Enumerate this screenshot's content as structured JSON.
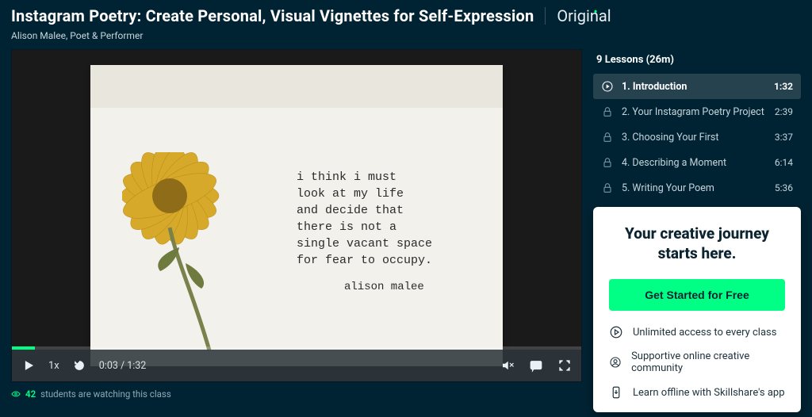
{
  "header": {
    "title": "Instagram Poetry: Create Personal, Visual Vignettes for Self-Expression",
    "badge": "Original",
    "author": "Alison Malee, Poet & Performer"
  },
  "video": {
    "poem_text": "i think i must\nlook at my life\nand decide that\nthere is not a\nsingle vacant space\nfor fear to occupy.",
    "poem_signature": "alison malee",
    "speed": "1x",
    "current_time": "0:03",
    "duration": "1:32",
    "watching_count": "42",
    "watching_suffix": "students are watching this class"
  },
  "lessons": {
    "header": "9 Lessons (26m)",
    "items": [
      {
        "label": "1. Introduction",
        "duration": "1:32",
        "active": true
      },
      {
        "label": "2. Your Instagram Poetry Project",
        "duration": "2:39",
        "active": false
      },
      {
        "label": "3. Choosing Your First",
        "duration": "3:37",
        "active": false
      },
      {
        "label": "4. Describing a Moment",
        "duration": "6:14",
        "active": false
      },
      {
        "label": "5. Writing Your Poem",
        "duration": "5:36",
        "active": false
      }
    ]
  },
  "cta": {
    "title_line1": "Your creative journey",
    "title_line2": "starts here.",
    "button": "Get Started for Free",
    "benefits": [
      "Unlimited access to every class",
      "Supportive online creative community",
      "Learn offline with Skillshare's app"
    ]
  }
}
